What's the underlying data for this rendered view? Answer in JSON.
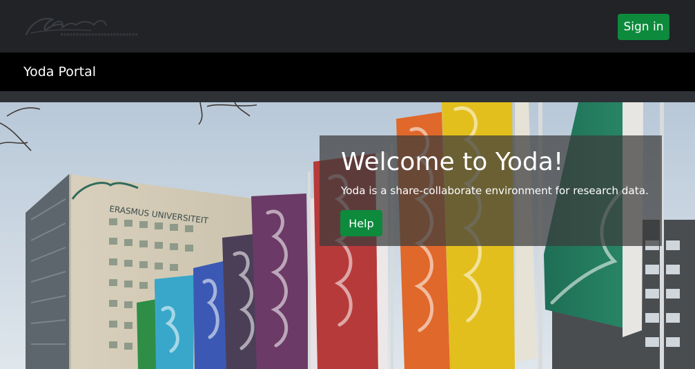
{
  "header": {
    "logo_icon": "erasmus-logo-icon",
    "signin_label": "Sign in"
  },
  "portal": {
    "title": "Yoda Portal"
  },
  "hero": {
    "building_sign": "ERASMUS UNIVERSITEIT",
    "heading": "Welcome to Yoda!",
    "text": "Yoda is a share-collaborate environment for research data.",
    "help_label": "Help"
  },
  "colors": {
    "topbar": "#212327",
    "portalbar": "#000000",
    "button": "#0d8a3c",
    "overlay": "#3c3c3c"
  }
}
